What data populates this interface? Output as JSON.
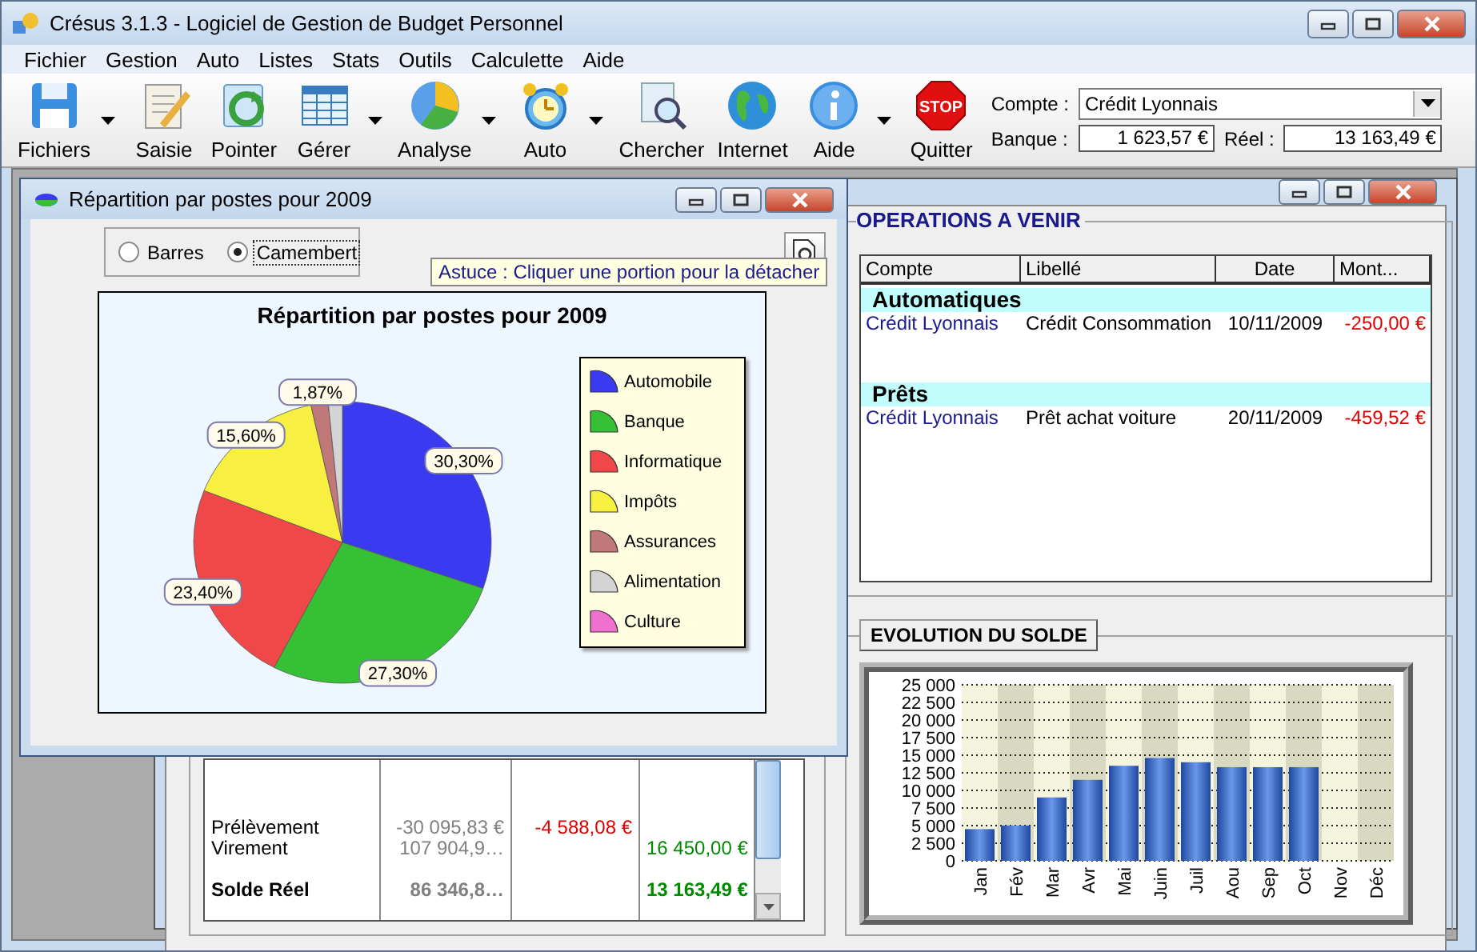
{
  "window": {
    "title": "Crésus 3.1.3 - Logiciel de Gestion de Budget Personnel"
  },
  "menu": [
    "Fichier",
    "Gestion",
    "Auto",
    "Listes",
    "Stats",
    "Outils",
    "Calculette",
    "Aide"
  ],
  "toolbar": [
    {
      "label": "Fichiers",
      "kind": "floppy",
      "dropdown": true
    },
    {
      "label": "Saisie",
      "kind": "note",
      "dropdown": false
    },
    {
      "label": "Pointer",
      "kind": "sync",
      "dropdown": false
    },
    {
      "label": "Gérer",
      "kind": "grid",
      "dropdown": true
    },
    {
      "label": "Analyse",
      "kind": "pie",
      "dropdown": true
    },
    {
      "label": "Auto",
      "kind": "alarm",
      "dropdown": true
    },
    {
      "label": "Chercher",
      "kind": "search",
      "dropdown": false
    },
    {
      "label": "Internet",
      "kind": "globe",
      "dropdown": false
    },
    {
      "label": "Aide",
      "kind": "info",
      "dropdown": true
    },
    {
      "label": "Quitter",
      "kind": "stop",
      "icon_text": "STOP",
      "dropdown": false
    }
  ],
  "account": {
    "compte_label": "Compte :",
    "compte": "Crédit Lyonnais",
    "banque_label": "Banque :",
    "banque": "1 623,57 €",
    "reel_label": "Réel :",
    "reel": "13 163,49 €"
  },
  "popup": {
    "title": "Répartition par postes pour 2009",
    "modes": [
      {
        "label": "Barres",
        "selected": false
      },
      {
        "label": "Camembert",
        "selected": true
      }
    ],
    "tip": "Astuce : Cliquer une portion pour la détacher",
    "chart_data": {
      "type": "pie",
      "title": "Répartition par postes pour 2009",
      "categories": [
        "Automobile",
        "Banque",
        "Informatique",
        "Impôts",
        "Assurances",
        "Alimentation",
        "Culture"
      ],
      "values": [
        30.3,
        27.3,
        23.4,
        15.6,
        1.87,
        1.53,
        0
      ],
      "legend": "right",
      "colors": [
        "#3a3af0",
        "#36c036",
        "#f04848",
        "#f8f040",
        "#c07878",
        "#d4d4d4",
        "#f070d0"
      ],
      "value_labels": [
        "30,30%",
        "27,30%",
        "23,40%",
        "15,60%",
        "1,87%",
        null,
        null
      ]
    }
  },
  "solde_table": {
    "rows": [
      {
        "kind": "normal",
        "label": "Prélèvement",
        "col_2": "-30 095,83 €",
        "col_3": "-4 588,08 €"
      },
      {
        "kind": "normal",
        "label": "Virement",
        "col_2": "107 904,9…",
        "col_4": "16 450,00 €"
      },
      {
        "kind": "total",
        "label": "Solde Réel",
        "col_2": "86 346,8…",
        "col_4": "13 163,49 €"
      }
    ]
  },
  "operations": {
    "title": "OPERATIONS A VENIR",
    "columns": [
      "Compte",
      "Libellé",
      "Date",
      "Mont..."
    ],
    "groups": [
      {
        "name": "Automatiques",
        "rows": [
          {
            "compte": "Crédit Lyonnais",
            "libelle": "Crédit Consommation",
            "date": "10/11/2009",
            "montant": "-250,00 €"
          }
        ]
      },
      {
        "name": "Prêts",
        "rows": [
          {
            "compte": "Crédit Lyonnais",
            "libelle": "Prêt achat voiture",
            "date": "20/11/2009",
            "montant": "-459,52 €"
          }
        ]
      }
    ]
  },
  "evolution": {
    "title": "EVOLUTION DU SOLDE",
    "chart_data": {
      "type": "bar",
      "categories": [
        "Jan",
        "Fév",
        "Mar",
        "Avr",
        "Mai",
        "Juin",
        "Juil",
        "Aou",
        "Sep",
        "Oct",
        "Nov",
        "Déc"
      ],
      "grid": true,
      "series": [
        {
          "color": "#1e48a0",
          "values": [
            4500,
            5000,
            9000,
            11500,
            13500,
            14600,
            14000,
            13300,
            13300,
            13300,
            null,
            null
          ]
        }
      ],
      "ylim": [
        0,
        25000
      ],
      "yticks": [
        {
          "value": 0,
          "label": "0"
        },
        {
          "value": 2500,
          "label": "2 500"
        },
        {
          "value": 5000,
          "label": "5 000"
        },
        {
          "value": 7500,
          "label": "7 500"
        },
        {
          "value": 10000,
          "label": "10 000"
        },
        {
          "value": 12500,
          "label": "12 500"
        },
        {
          "value": 15000,
          "label": "15 000"
        },
        {
          "value": 17500,
          "label": "17 500"
        },
        {
          "value": 20000,
          "label": "20 000"
        },
        {
          "value": 22500,
          "label": "22 500"
        },
        {
          "value": 25000,
          "label": "25 000"
        }
      ]
    }
  }
}
